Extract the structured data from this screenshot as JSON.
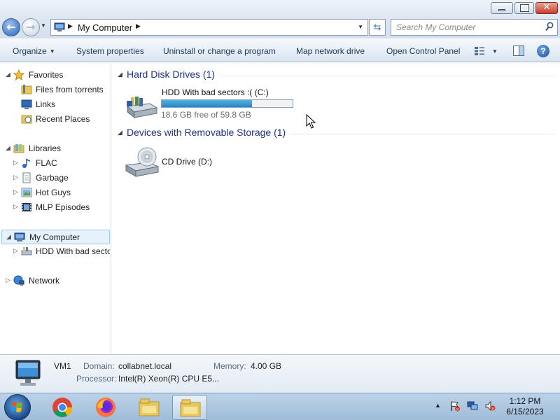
{
  "window": {
    "buttons": {
      "minimize": "",
      "maximize": "",
      "close": "✕"
    }
  },
  "address": {
    "location": "My Computer",
    "search_placeholder": "Search My Computer"
  },
  "toolbar": {
    "organize": "Organize",
    "system_properties": "System properties",
    "uninstall": "Uninstall or change a program",
    "map_network": "Map network drive",
    "control_panel": "Open Control Panel"
  },
  "nav": {
    "favorites": "Favorites",
    "files_from_torrents": "Files from torrents",
    "links": "Links",
    "recent_places": "Recent Places",
    "libraries": "Libraries",
    "flac": "FLAC",
    "garbage": "Garbage",
    "hot_guys": "Hot Guys",
    "mlp_episodes": "MLP Episodes",
    "my_computer": "My Computer",
    "hdd": "HDD With bad sectors :( (C:)",
    "network": "Network"
  },
  "content": {
    "hdd_group": "Hard Disk Drives (1)",
    "hdd_name": "HDD With bad sectors :( (C:)",
    "hdd_free": "18.6 GB free of 59.8 GB",
    "hdd_used_fraction": 0.689,
    "removable_group": "Devices with Removable Storage (1)",
    "cd_name": "CD Drive (D:)"
  },
  "details": {
    "name": "VM1",
    "domain_label": "Domain:",
    "domain_value": "collabnet.local",
    "memory_label": "Memory:",
    "memory_value": "4.00 GB",
    "processor_label": "Processor:",
    "processor_value": "Intel(R) Xeon(R) CPU E5..."
  },
  "taskbar": {
    "time": "1:12 PM",
    "date": "6/15/2023"
  },
  "colors": {
    "accent": "#1e3287",
    "usage_bar": "#2686c6",
    "selection": "#e5f1fb"
  }
}
